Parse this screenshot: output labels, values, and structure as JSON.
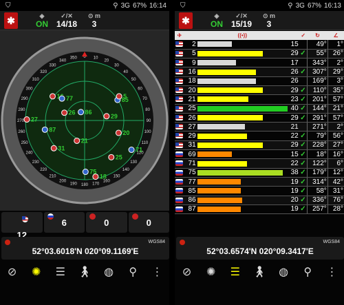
{
  "left": {
    "status": {
      "network": "3G",
      "battery": "67%",
      "time": "16:14"
    },
    "toolbar": {
      "logo": "✱",
      "fix": "ON",
      "sats": "14/18",
      "count": "3"
    },
    "radar": {
      "satellites": [
        {
          "id": "27",
          "flag": "us"
        },
        {
          "id": "16",
          "flag": "us"
        },
        {
          "id": "77",
          "flag": "ru"
        },
        {
          "id": "87",
          "flag": "ru"
        },
        {
          "id": "26",
          "flag": "us"
        },
        {
          "id": "86",
          "flag": "ru"
        },
        {
          "id": "31",
          "flag": "us"
        },
        {
          "id": "21",
          "flag": "us"
        },
        {
          "id": "29",
          "flag": "us"
        },
        {
          "id": "85",
          "flag": "ru"
        },
        {
          "id": "75",
          "flag": "ru"
        },
        {
          "id": "18",
          "flag": "us"
        },
        {
          "id": "20",
          "flag": "us"
        },
        {
          "id": "25",
          "flag": "us"
        },
        {
          "id": "71",
          "flag": "ru"
        },
        {
          "id": "5",
          "flag": "us"
        }
      ],
      "compass_labels": [
        "330",
        "340",
        "350",
        "0",
        "10",
        "20",
        "30",
        "40",
        "50",
        "60",
        "70",
        "80",
        "90",
        "100",
        "110",
        "120",
        "130",
        "140",
        "150",
        "160",
        "170",
        "180",
        "190",
        "200",
        "210",
        "220",
        "230",
        "240",
        "250",
        "260",
        "270",
        "280",
        "290",
        "300",
        "310",
        "320"
      ]
    },
    "counts": [
      "12",
      "6",
      "0",
      "0"
    ],
    "coords": {
      "text": "52°03.6018'N  020°09.1169'E",
      "datum": "WGS84"
    }
  },
  "right": {
    "status": {
      "network": "3G",
      "battery": "67%",
      "time": "16:13"
    },
    "toolbar": {
      "fix": "ON",
      "sats": "15/19",
      "count": "3"
    },
    "rows": [
      {
        "prn": "2",
        "flag": "us",
        "snr": "15",
        "used": "",
        "az": "49°",
        "el": "1°",
        "color": "#d8d8d8"
      },
      {
        "prn": "5",
        "flag": "us",
        "snr": "29",
        "used": "✓",
        "az": "55°",
        "el": "26°",
        "color": "#ffff00"
      },
      {
        "prn": "9",
        "flag": "us",
        "snr": "17",
        "used": "",
        "az": "343°",
        "el": "2°",
        "color": "#d8d8d8"
      },
      {
        "prn": "16",
        "flag": "us",
        "snr": "26",
        "used": "✓",
        "az": "307°",
        "el": "29°",
        "color": "#ffff00"
      },
      {
        "prn": "18",
        "flag": "us",
        "snr": "26",
        "used": "",
        "az": "169°",
        "el": "3°",
        "color": "#d8d8d8"
      },
      {
        "prn": "20",
        "flag": "us",
        "snr": "29",
        "used": "✓",
        "az": "110°",
        "el": "35°",
        "color": "#ffff00"
      },
      {
        "prn": "21",
        "flag": "us",
        "snr": "23",
        "used": "✓",
        "az": "201°",
        "el": "57°",
        "color": "#ffff00"
      },
      {
        "prn": "25",
        "flag": "us",
        "snr": "40",
        "used": "✓",
        "az": "144°",
        "el": "21°",
        "color": "#22cc22"
      },
      {
        "prn": "26",
        "flag": "us",
        "snr": "29",
        "used": "✓",
        "az": "291°",
        "el": "57°",
        "color": "#ffff00"
      },
      {
        "prn": "27",
        "flag": "us",
        "snr": "21",
        "used": "",
        "az": "271°",
        "el": "2°",
        "color": "#d8d8d8"
      },
      {
        "prn": "29",
        "flag": "us",
        "snr": "22",
        "used": "✓",
        "az": "79°",
        "el": "56°",
        "color": "#ffff00"
      },
      {
        "prn": "31",
        "flag": "us",
        "snr": "29",
        "used": "✓",
        "az": "228°",
        "el": "27°",
        "color": "#ffff00"
      },
      {
        "prn": "69",
        "flag": "ru",
        "snr": "15",
        "used": "✓",
        "az": "18°",
        "el": "16°",
        "color": "#ff8800"
      },
      {
        "prn": "71",
        "flag": "ru",
        "snr": "22",
        "used": "✓",
        "az": "122°",
        "el": "6°",
        "color": "#ffff00"
      },
      {
        "prn": "75",
        "flag": "ru",
        "snr": "38",
        "used": "✓",
        "az": "179°",
        "el": "12°",
        "color": "#aadd22"
      },
      {
        "prn": "77",
        "flag": "ru",
        "snr": "19",
        "used": "✓",
        "az": "314°",
        "el": "42°",
        "color": "#ff8800"
      },
      {
        "prn": "85",
        "flag": "ru",
        "snr": "19",
        "used": "✓",
        "az": "58°",
        "el": "31°",
        "color": "#ff8800"
      },
      {
        "prn": "86",
        "flag": "ru",
        "snr": "20",
        "used": "✓",
        "az": "336°",
        "el": "76°",
        "color": "#ff8800"
      },
      {
        "prn": "87",
        "flag": "ru",
        "snr": "19",
        "used": "✓",
        "az": "257°",
        "el": "28°",
        "color": "#ff8800"
      }
    ],
    "coords": {
      "text": "52°03.6574'N  020°09.3417'E",
      "datum": "WGS84"
    }
  },
  "bottom_icons": [
    "compass-icon",
    "radar-icon",
    "signal-bars-icon",
    "walk-icon",
    "globe-icon",
    "location-pin-icon",
    "more-icon"
  ]
}
